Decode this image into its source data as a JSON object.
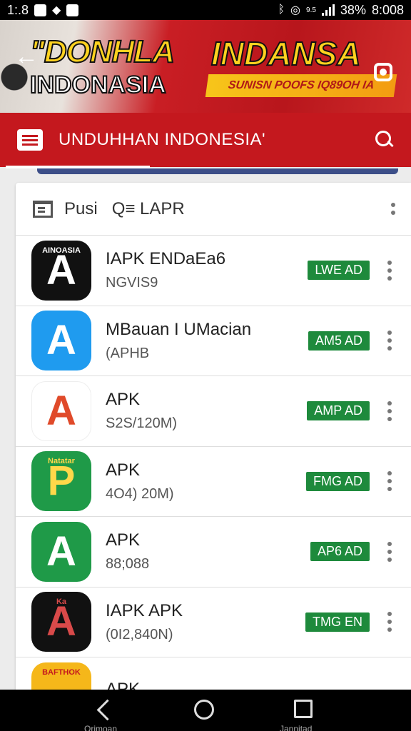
{
  "status_bar": {
    "time_left": "1:.8",
    "battery": "38%",
    "clock": "8:008",
    "net": "9.5"
  },
  "banner": {
    "title_line1": "\"DONHLA",
    "title_line2": "INDONASIA",
    "title_right": "INDANSA",
    "ribbon_text": "SUNISN POOFS IQ89OH IA"
  },
  "app_bar": {
    "title": "UNDUHHAN INDONESIA'"
  },
  "card_header": {
    "label": "Pusi",
    "search_text": "Q≡ LAPR"
  },
  "apps": [
    {
      "name": "IAPK ENDaEa6",
      "sub": "NGVIS9",
      "badge": "LWE AD",
      "icon_bg": "#111111",
      "icon_fg": "#ffffff",
      "icon_tag": "AINOASIA",
      "icon_glyph": "A"
    },
    {
      "name": "MBauan I UMacian",
      "sub": "(APHB",
      "badge": "AM5 AD",
      "icon_bg": "#1f9bef",
      "icon_fg": "#ffffff",
      "icon_tag": "",
      "icon_glyph": "A"
    },
    {
      "name": "APK",
      "sub": "S2S/120M)",
      "badge": "AMP AD",
      "icon_bg": "#ffffff",
      "icon_fg": "#e04a2a",
      "icon_tag": "",
      "icon_glyph": "A"
    },
    {
      "name": "APK",
      "sub": "4O4) 20M)",
      "badge": "FMG AD",
      "icon_bg": "#1f9a48",
      "icon_fg": "#ffd84a",
      "icon_tag": "Natatar",
      "icon_glyph": "P"
    },
    {
      "name": "APK",
      "sub": "88;088",
      "badge": "AP6 AD",
      "icon_bg": "#1f9a48",
      "icon_fg": "#ffffff",
      "icon_tag": "",
      "icon_glyph": "A"
    },
    {
      "name": "IAPK APK",
      "sub": "(0I2,840N)",
      "badge": "TMG EN",
      "icon_bg": "#111111",
      "icon_fg": "#d94a4a",
      "icon_tag": "Ka",
      "icon_glyph": "A"
    },
    {
      "name": "APK",
      "sub": "",
      "badge": "",
      "icon_bg": "#f5b71a",
      "icon_fg": "#c4181e",
      "icon_tag": "BAFTHOK",
      "icon_glyph": ""
    }
  ],
  "nav_bar": {
    "back_label": "Qrimoan",
    "recent_label": "Jannitad"
  }
}
